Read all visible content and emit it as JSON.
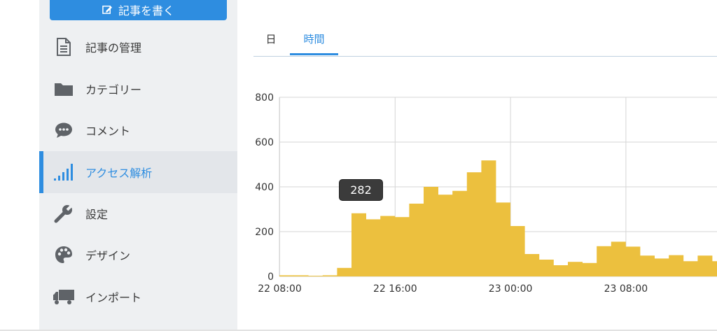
{
  "sidebar": {
    "write_button": "記事を書く",
    "items": [
      {
        "label": "記事の管理",
        "icon": "document-icon"
      },
      {
        "label": "カテゴリー",
        "icon": "folder-icon"
      },
      {
        "label": "コメント",
        "icon": "comment-icon"
      },
      {
        "label": "アクセス解析",
        "icon": "signal-bars-icon",
        "active": true
      },
      {
        "label": "設定",
        "icon": "wrench-icon"
      },
      {
        "label": "デザイン",
        "icon": "palette-icon"
      },
      {
        "label": "インポート",
        "icon": "truck-icon"
      }
    ]
  },
  "tabs": [
    {
      "label": "日"
    },
    {
      "label": "時間",
      "active": true
    }
  ],
  "tooltip": {
    "value": "282"
  },
  "colors": {
    "accent": "#2e8de0",
    "bar": "#ecc03e",
    "grid": "#d6d6d6"
  },
  "chart_data": {
    "type": "bar",
    "ylim": [
      0,
      800
    ],
    "yticks": [
      0,
      200,
      400,
      600,
      800
    ],
    "xtick_labels": [
      "22 08:00",
      "22 16:00",
      "23 00:00",
      "23 08:00"
    ],
    "xtick_index": [
      0,
      8,
      16,
      24
    ],
    "values": [
      5,
      5,
      3,
      5,
      38,
      282,
      255,
      270,
      265,
      325,
      400,
      365,
      382,
      465,
      518,
      330,
      225,
      100,
      75,
      50,
      65,
      60,
      135,
      155,
      133,
      93,
      80,
      95,
      68,
      93,
      68
    ],
    "grid": true,
    "highlight_index": 5
  }
}
